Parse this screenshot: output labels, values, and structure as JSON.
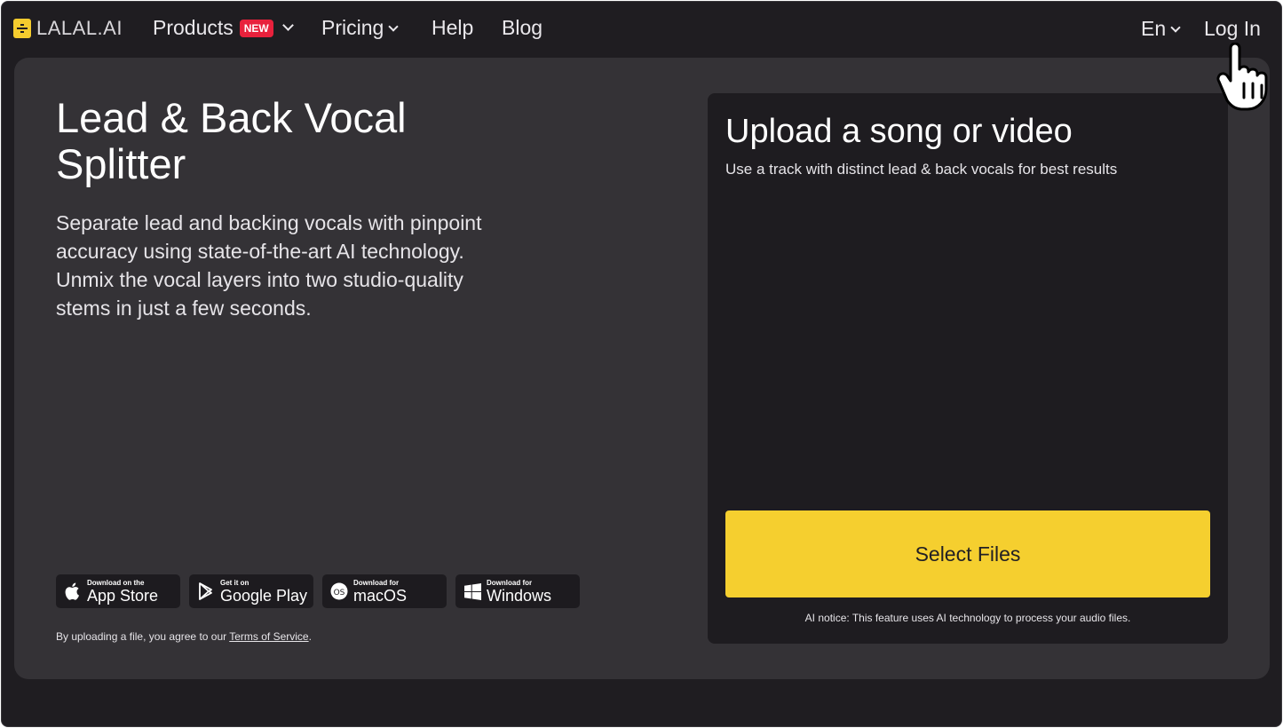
{
  "nav": {
    "logo_text": "LALAL.AI",
    "products": "Products",
    "new_badge": "NEW",
    "pricing": "Pricing",
    "help": "Help",
    "blog": "Blog",
    "lang": "En",
    "login": "Log In"
  },
  "hero": {
    "title": "Lead & Back Vocal Splitter",
    "description": "Separate lead and backing vocals with pinpoint accuracy using state-of-the-art AI technology. Unmix the vocal layers into two studio-quality stems in just a few seconds."
  },
  "stores": [
    {
      "small": "Download on the",
      "big": "App Store",
      "icon": "apple-icon"
    },
    {
      "small": "Get it on",
      "big": "Google Play",
      "icon": "google-play-icon"
    },
    {
      "small": "Download for",
      "big": "macOS",
      "icon": "macos-icon"
    },
    {
      "small": "Download for",
      "big": "Windows",
      "icon": "windows-icon"
    }
  ],
  "terms": {
    "prefix": "By uploading a file, you agree to our ",
    "link": "Terms of Service",
    "suffix": "."
  },
  "upload": {
    "title": "Upload a song or video",
    "subtitle": "Use a track with distinct lead & back vocals for best results",
    "button": "Select Files",
    "notice": "AI notice: This feature uses AI technology to process your audio files."
  },
  "colors": {
    "accent": "#f5cf2f",
    "badge": "#e8213c",
    "page_bg": "#1f1d21",
    "card_bg": "#343236",
    "panel_bg": "#1e1c20"
  }
}
